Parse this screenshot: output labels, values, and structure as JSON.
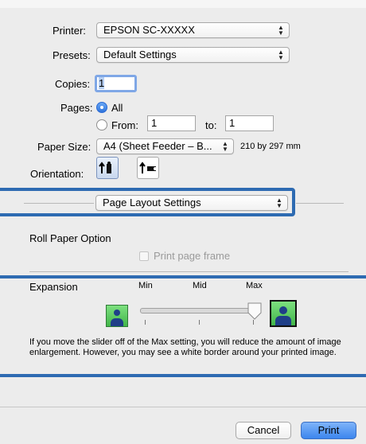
{
  "printer": {
    "label": "Printer:",
    "value": "EPSON SC-XXXXX"
  },
  "presets": {
    "label": "Presets:",
    "value": "Default Settings"
  },
  "copies": {
    "label": "Copies:",
    "value": "1"
  },
  "pages": {
    "label": "Pages:",
    "all_label": "All",
    "from_label": "From:",
    "from_value": "1",
    "to_label": "to:",
    "to_value": "1",
    "selected": "All"
  },
  "paper_size": {
    "label": "Paper Size:",
    "value": "A4 (Sheet Feeder – B...",
    "dimensions": "210 by 297 mm"
  },
  "orientation": {
    "label": "Orientation:",
    "options": [
      "portrait-icon",
      "landscape-icon"
    ],
    "selected": "portrait"
  },
  "section_popup": {
    "value": "Page Layout Settings"
  },
  "roll_paper": {
    "title": "Roll Paper Option",
    "print_frame_label": "Print page frame",
    "print_frame_checked": false
  },
  "expansion": {
    "label": "Expansion",
    "min_label": "Min",
    "mid_label": "Mid",
    "max_label": "Max",
    "level": "Max",
    "note": "If you move the slider off of the Max setting, you will reduce the amount of image enlargement. However, you may see a white border around your printed image."
  },
  "buttons": {
    "cancel": "Cancel",
    "print": "Print"
  },
  "colors": {
    "highlight_blue": "#2e6bb2",
    "default_button": "#3c86ee"
  }
}
